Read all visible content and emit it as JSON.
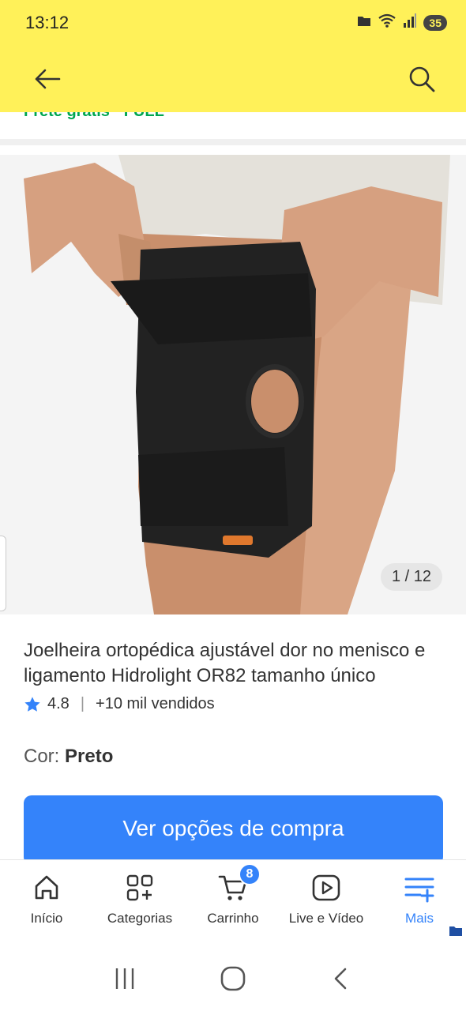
{
  "status_bar": {
    "time": "13:12",
    "battery": "35",
    "icons": [
      "folder-icon",
      "wifi-icon",
      "signal-icon"
    ]
  },
  "header": {
    "back_icon": "arrow-left-icon",
    "search_icon": "search-icon",
    "background": "#fff159"
  },
  "shipping_peek": "Frete grátis · FULL",
  "gallery": {
    "counter": "1 / 12"
  },
  "product": {
    "title": "Joelheira ortopédica ajustável dor no menisco e ligamento Hidrolight OR82 tamanho único",
    "rating": "4.8",
    "sold": "+10 mil vendidos",
    "color_label": "Cor:",
    "color_value": "Preto"
  },
  "buy_button": {
    "label": "Ver opções de compra",
    "color": "#3483fa"
  },
  "bottom_nav": {
    "items": [
      {
        "label": "Início",
        "icon": "home-icon"
      },
      {
        "label": "Categorias",
        "icon": "categories-icon"
      },
      {
        "label": "Carrinho",
        "icon": "cart-icon",
        "badge": "8"
      },
      {
        "label": "Live e Vídeo",
        "icon": "play-video-icon"
      },
      {
        "label": "Mais",
        "icon": "menu-plus-icon",
        "active": true
      }
    ]
  },
  "system_nav": {
    "icons": [
      "recent-apps-icon",
      "home-circle-icon",
      "back-chevron-icon"
    ]
  }
}
